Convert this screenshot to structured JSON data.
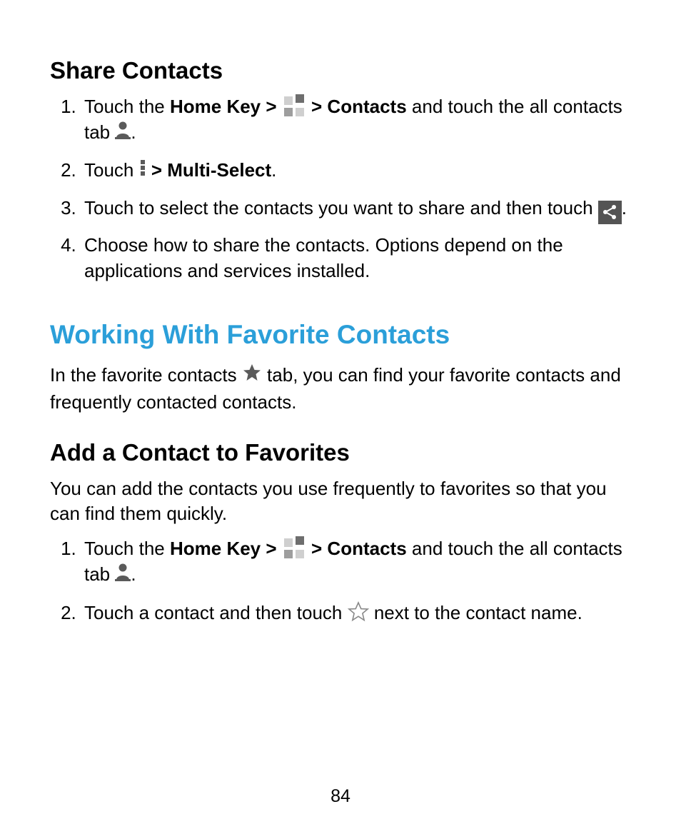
{
  "section1": {
    "title": "Share Contacts",
    "steps": {
      "s1_a": "Touch the ",
      "s1_b": "Home Key > ",
      "s1_c": " > Contacts",
      "s1_d": " and touch the all contacts tab ",
      "s1_e": ".",
      "s2_a": "Touch ",
      "s2_b": " > Multi-Select",
      "s2_c": ".",
      "s3_a": "Touch to select the contacts you want to share and then touch ",
      "s3_b": ".",
      "s4": "Choose how to share the contacts. Options depend on the applications and services installed."
    }
  },
  "section2": {
    "title": "Working With Favorite Contacts",
    "intro_a": "In the favorite contacts ",
    "intro_b": " tab, you can find your favorite contacts and frequently contacted contacts."
  },
  "section3": {
    "title": "Add a Contact to Favorites",
    "intro": "You can add the contacts you use frequently to favorites so that you can find them quickly.",
    "steps": {
      "s1_a": "Touch the ",
      "s1_b": "Home Key > ",
      "s1_c": " > Contacts",
      "s1_d": " and touch the all contacts tab ",
      "s1_e": ".",
      "s2_a": "Touch a contact and then touch ",
      "s2_b": " next to the contact name."
    }
  },
  "page_number": "84"
}
